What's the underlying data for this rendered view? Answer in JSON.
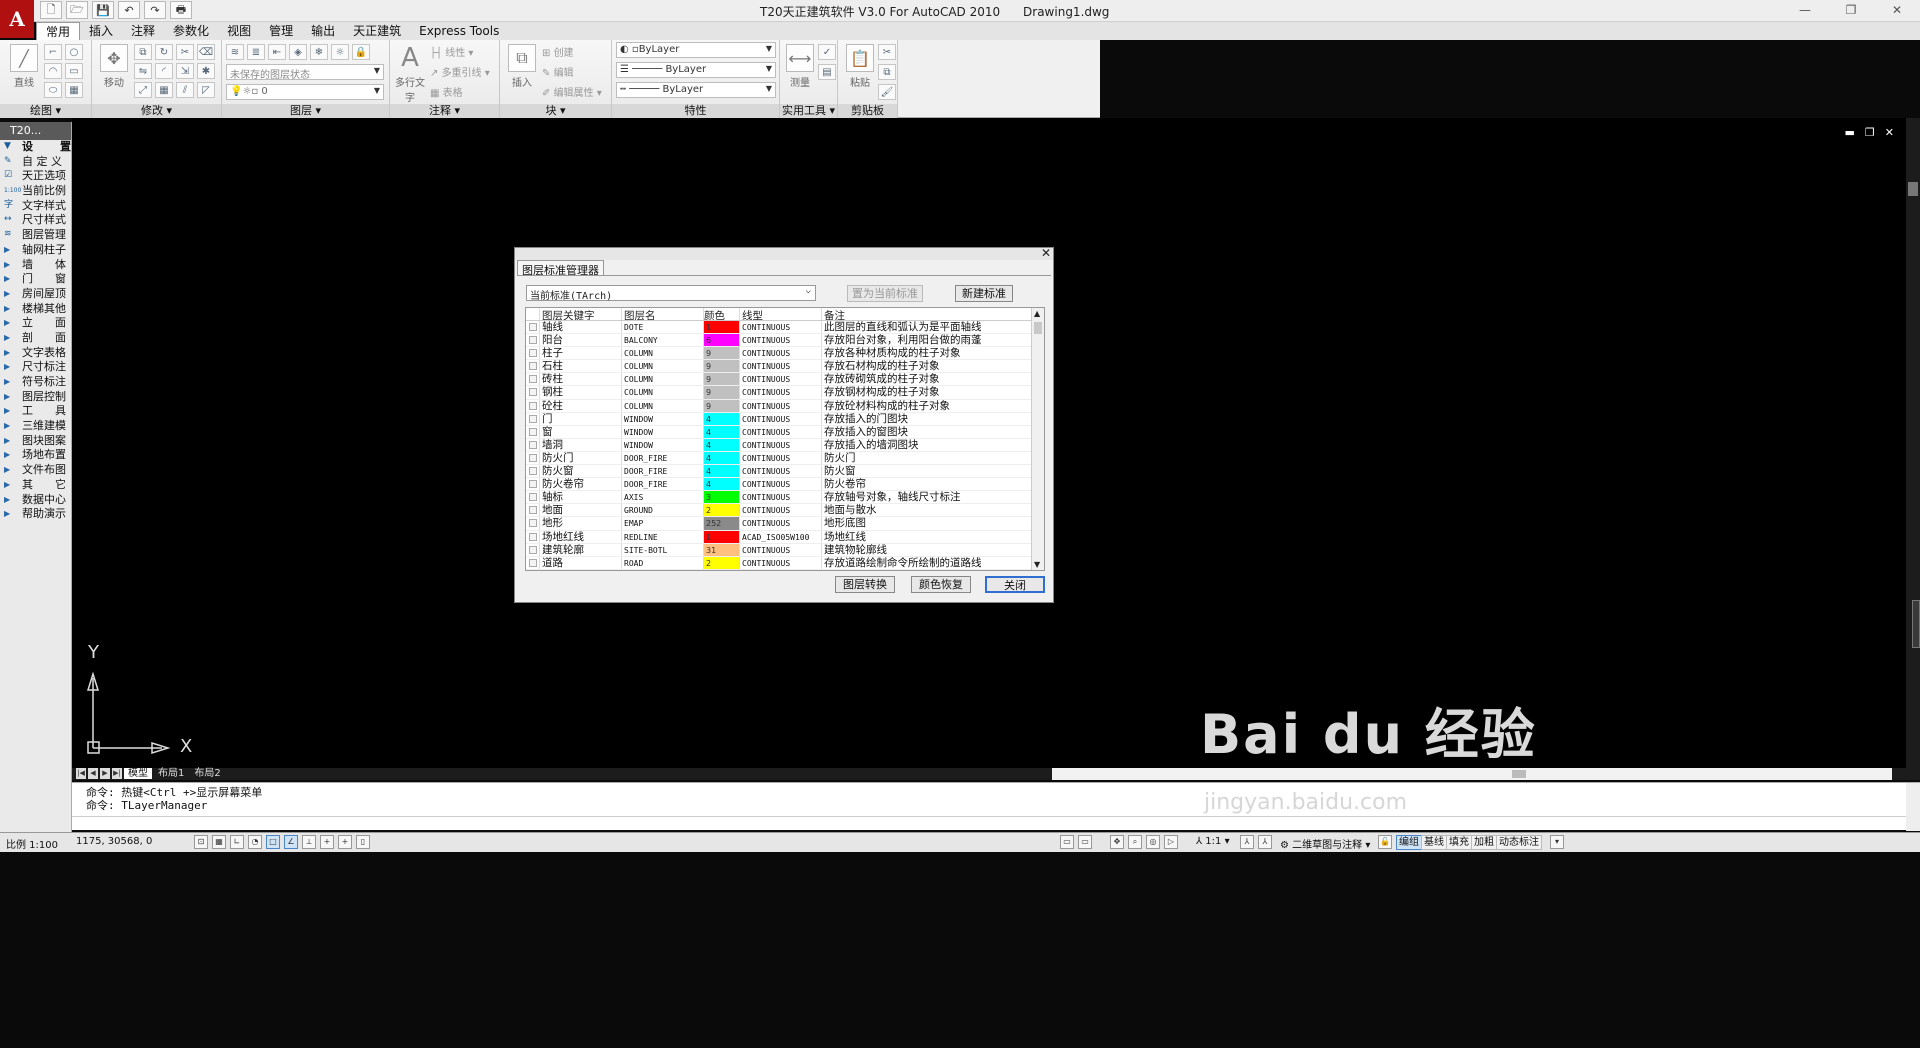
{
  "window": {
    "title": "T20天正建筑软件 V3.0 For AutoCAD 2010",
    "document": "Drawing1.dwg",
    "logo": "A",
    "controls": [
      "—",
      "❐",
      "✕"
    ]
  },
  "quick_access": [
    "🗋",
    "🗁",
    "💾",
    "↶",
    "↷",
    "🖶"
  ],
  "ribbon_tabs": [
    "常用",
    "插入",
    "注释",
    "参数化",
    "视图",
    "管理",
    "输出",
    "天正建筑",
    "Express Tools"
  ],
  "ribbon": {
    "draw": {
      "title": "绘图 ▾",
      "line_label": "直线"
    },
    "modify": {
      "title": "修改 ▾",
      "move_label": "移动"
    },
    "layers": {
      "title": "图层 ▾",
      "state": "未保存的图层状态",
      "layer_value": "0"
    },
    "annotation": {
      "title": "注释 ▾",
      "mtext_label": "多行文字",
      "linear": "线性",
      "mleader": "多重引线",
      "table": "表格"
    },
    "block": {
      "title": "块 ▾",
      "insert": "插入",
      "create": "创建",
      "edit": "编辑",
      "edit_attr": "编辑属性"
    },
    "properties": {
      "title": "特性",
      "color": "ByLayer",
      "linetype": "ByLayer",
      "lineweight": "ByLayer"
    },
    "utilities": {
      "title": "实用工具 ▾",
      "measure": "测量"
    },
    "clipboard": {
      "title": "剪贴板",
      "paste": "粘贴"
    }
  },
  "tpal": {
    "header": "T20...",
    "items": [
      {
        "label": "设　置",
        "icon": "▼",
        "kind": "hdr"
      },
      {
        "label": "自 定 义",
        "icon": "✎"
      },
      {
        "label": "天正选项",
        "icon": "☑"
      },
      {
        "label": "当前比例",
        "icon": "1:100"
      },
      {
        "label": "文字样式",
        "icon": "字"
      },
      {
        "label": "尺寸样式",
        "icon": "↔"
      },
      {
        "label": "图层管理",
        "icon": "≋"
      },
      {
        "label": "轴网柱子",
        "icon": "▶",
        "kind": "grp"
      },
      {
        "label": "墙　　体",
        "icon": "▶",
        "kind": "grp"
      },
      {
        "label": "门　　窗",
        "icon": "▶",
        "kind": "grp"
      },
      {
        "label": "房间屋顶",
        "icon": "▶",
        "kind": "grp"
      },
      {
        "label": "楼梯其他",
        "icon": "▶",
        "kind": "grp"
      },
      {
        "label": "立　　面",
        "icon": "▶",
        "kind": "grp"
      },
      {
        "label": "剖　　面",
        "icon": "▶",
        "kind": "grp"
      },
      {
        "label": "文字表格",
        "icon": "▶",
        "kind": "grp"
      },
      {
        "label": "尺寸标注",
        "icon": "▶",
        "kind": "grp"
      },
      {
        "label": "符号标注",
        "icon": "▶",
        "kind": "grp"
      },
      {
        "label": "图层控制",
        "icon": "▶",
        "kind": "grp"
      },
      {
        "label": "工　　具",
        "icon": "▶",
        "kind": "grp"
      },
      {
        "label": "三维建模",
        "icon": "▶",
        "kind": "grp"
      },
      {
        "label": "图块图案",
        "icon": "▶",
        "kind": "grp"
      },
      {
        "label": "场地布置",
        "icon": "▶",
        "kind": "grp"
      },
      {
        "label": "文件布图",
        "icon": "▶",
        "kind": "grp"
      },
      {
        "label": "其　　它",
        "icon": "▶",
        "kind": "grp"
      },
      {
        "label": "数据中心",
        "icon": "▶",
        "kind": "grp"
      },
      {
        "label": "帮助演示",
        "icon": "▶",
        "kind": "grp"
      }
    ]
  },
  "viewport_controls": [
    "▬",
    "❐",
    "✕"
  ],
  "ucs": {
    "y": "Y",
    "x": "X"
  },
  "dialog": {
    "close": "✕",
    "title": "图层标准管理器",
    "standard": "当前标准(TArch)",
    "btn_set_current": "置为当前标准",
    "btn_new": "新建标准",
    "columns": [
      "图层关键字",
      "图层名",
      "颜色",
      "线型",
      "备注"
    ],
    "rows": [
      {
        "key": "轴线",
        "name": "DOTE",
        "color": "1",
        "hex": "#ff0000",
        "ltype": "CONTINUOUS",
        "note": "此图层的直线和弧认为是平面轴线"
      },
      {
        "key": "阳台",
        "name": "BALCONY",
        "color": "6",
        "hex": "#ff00ff",
        "ltype": "CONTINUOUS",
        "note": "存放阳台对象，利用阳台做的雨蓬"
      },
      {
        "key": "柱子",
        "name": "COLUMN",
        "color": "9",
        "hex": "#c0c0c0",
        "ltype": "CONTINUOUS",
        "note": "存放各种材质构成的柱子对象"
      },
      {
        "key": "石柱",
        "name": "COLUMN",
        "color": "9",
        "hex": "#c0c0c0",
        "ltype": "CONTINUOUS",
        "note": "存放石材构成的柱子对象"
      },
      {
        "key": "砖柱",
        "name": "COLUMN",
        "color": "9",
        "hex": "#c0c0c0",
        "ltype": "CONTINUOUS",
        "note": "存放砖砌筑成的柱子对象"
      },
      {
        "key": "钢柱",
        "name": "COLUMN",
        "color": "9",
        "hex": "#c0c0c0",
        "ltype": "CONTINUOUS",
        "note": "存放钢材构成的柱子对象"
      },
      {
        "key": "砼柱",
        "name": "COLUMN",
        "color": "9",
        "hex": "#c0c0c0",
        "ltype": "CONTINUOUS",
        "note": "存放砼材料构成的柱子对象"
      },
      {
        "key": "门",
        "name": "WINDOW",
        "color": "4",
        "hex": "#00ffff",
        "ltype": "CONTINUOUS",
        "note": "存放插入的门图块"
      },
      {
        "key": "窗",
        "name": "WINDOW",
        "color": "4",
        "hex": "#00ffff",
        "ltype": "CONTINUOUS",
        "note": "存放插入的窗图块"
      },
      {
        "key": "墙洞",
        "name": "WINDOW",
        "color": "4",
        "hex": "#00ffff",
        "ltype": "CONTINUOUS",
        "note": "存放插入的墙洞图块"
      },
      {
        "key": "防火门",
        "name": "DOOR_FIRE",
        "color": "4",
        "hex": "#00ffff",
        "ltype": "CONTINUOUS",
        "note": "防火门"
      },
      {
        "key": "防火窗",
        "name": "DOOR_FIRE",
        "color": "4",
        "hex": "#00ffff",
        "ltype": "CONTINUOUS",
        "note": "防火窗"
      },
      {
        "key": "防火卷帘",
        "name": "DOOR_FIRE",
        "color": "4",
        "hex": "#00ffff",
        "ltype": "CONTINUOUS",
        "note": "防火卷帘"
      },
      {
        "key": "轴标",
        "name": "AXIS",
        "color": "3",
        "hex": "#00ff00",
        "ltype": "CONTINUOUS",
        "note": "存放轴号对象，轴线尺寸标注"
      },
      {
        "key": "地面",
        "name": "GROUND",
        "color": "2",
        "hex": "#ffff00",
        "ltype": "CONTINUOUS",
        "note": "地面与散水"
      },
      {
        "key": "地形",
        "name": "EMAP",
        "color": "252",
        "hex": "#8a8a8a",
        "ltype": "CONTINUOUS",
        "note": "地形底图"
      },
      {
        "key": "场地红线",
        "name": "REDLINE",
        "color": "1",
        "hex": "#ff0000",
        "ltype": "ACAD_ISO05W100",
        "note": "场地红线"
      },
      {
        "key": "建筑轮廓",
        "name": "SITE-BOTL",
        "color": "31",
        "hex": "#ffbf7f",
        "ltype": "CONTINUOUS",
        "note": "建筑物轮廓线"
      },
      {
        "key": "道路",
        "name": "ROAD",
        "color": "2",
        "hex": "#ffff00",
        "ltype": "CONTINUOUS",
        "note": "存放道路绘制命令所绘制的道路线"
      }
    ],
    "btn_convert": "图层转换",
    "btn_restore": "颜色恢复",
    "btn_close": "关闭"
  },
  "layout_tabs": [
    "模型",
    "布局1",
    "布局2"
  ],
  "command": {
    "line1": "命令: 热键<Ctrl +>显示屏幕菜单",
    "line2": "命令: TLayerManager"
  },
  "status": {
    "scale": "比例 1:100",
    "coords": "1175,  30568, 0",
    "anno_scale": "1:1",
    "workspace": "二维草图与注释",
    "toggles": [
      "编组",
      "基线",
      "填充",
      "加粗",
      "动态标注"
    ]
  },
  "watermark": {
    "brand": "Bai du 经验",
    "url": "jingyan.baidu.com"
  }
}
